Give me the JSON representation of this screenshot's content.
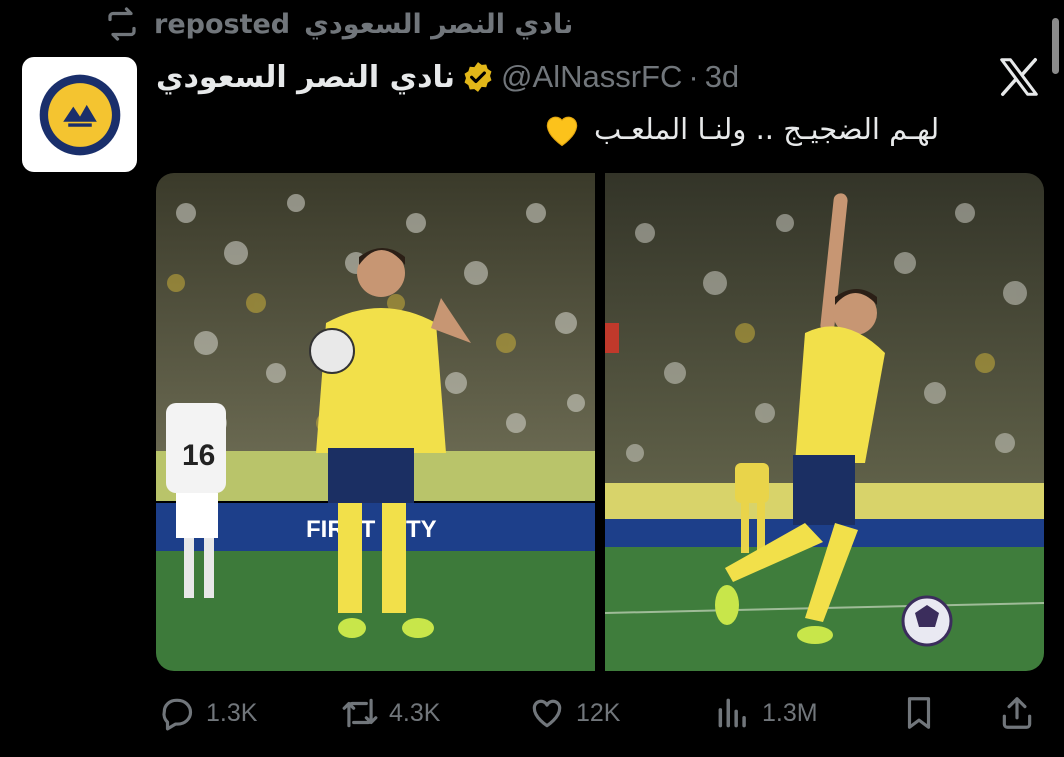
{
  "repost": {
    "label": "reposted",
    "by": "نادي النصر السعودي"
  },
  "author": {
    "name": "نادي النصر السعودي",
    "handle": "@AlNassrFC",
    "time": "3d",
    "separator": "·"
  },
  "tweet": {
    "text": "لهـم الضجيـج .. ولنـا الملعـب",
    "emoji": "yellow-heart"
  },
  "media": [
    {
      "name": "photo-player-celebrating-with-ball",
      "shirt_text": "FIRST CITY",
      "opponent_number": "16"
    },
    {
      "name": "photo-player-pointing-up"
    }
  ],
  "actions": {
    "replies": "1.3K",
    "reposts": "4.3K",
    "likes": "12K",
    "views": "1.3M"
  },
  "colors": {
    "accent_gold": "#f4c430",
    "muted": "#71767b",
    "background": "#000000"
  }
}
